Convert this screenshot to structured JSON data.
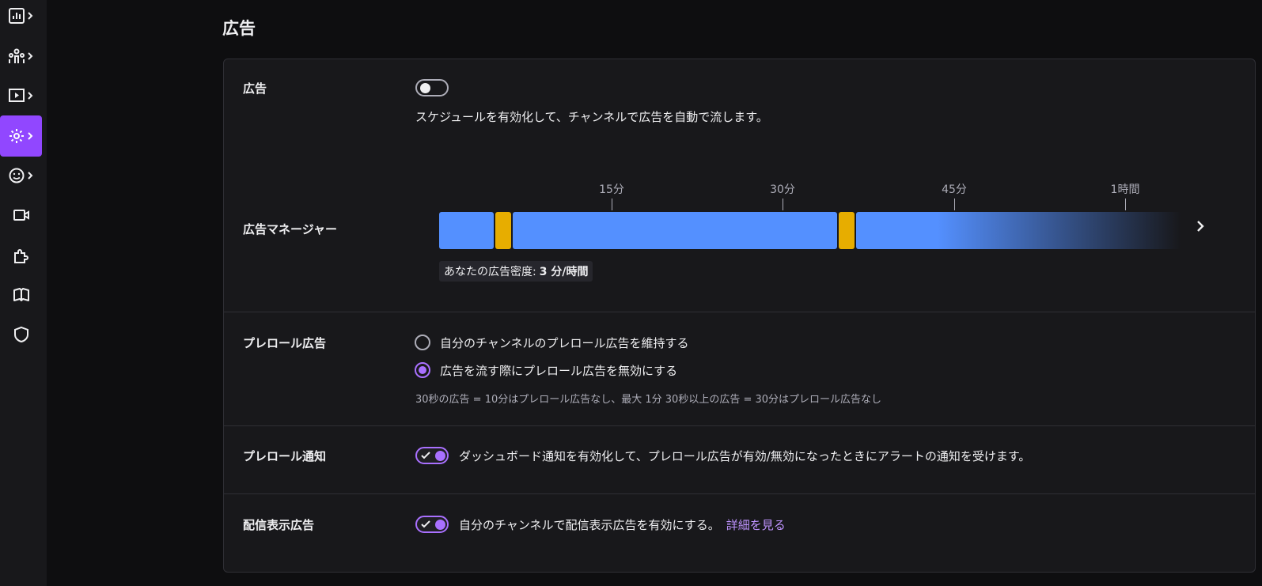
{
  "page": {
    "title": "広告"
  },
  "colors": {
    "accent": "#9147ff",
    "ad_blue": "#5490ff",
    "ad_gold": "#e7ad00",
    "link": "#bf94ff"
  },
  "sidebar": {
    "items": [
      {
        "icon": "analytics-icon",
        "expandable": true,
        "active": false
      },
      {
        "icon": "community-icon",
        "expandable": true,
        "active": false
      },
      {
        "icon": "content-icon",
        "expandable": true,
        "active": false
      },
      {
        "icon": "gear-icon",
        "expandable": true,
        "active": true
      },
      {
        "icon": "viewer-reward-icon",
        "expandable": true,
        "active": false
      },
      {
        "icon": "stream-video-icon",
        "expandable": false,
        "active": false
      },
      {
        "icon": "extensions-icon",
        "expandable": false,
        "active": false
      },
      {
        "icon": "book-icon",
        "expandable": false,
        "active": false
      },
      {
        "icon": "shield-icon",
        "expandable": false,
        "active": false
      }
    ]
  },
  "ads": {
    "label": "広告",
    "enabled": false,
    "description": "スケジュールを有効化して、チャンネルで広告を自動で流します。"
  },
  "ad_manager": {
    "label": "広告マネージャー",
    "ticks": [
      "15分",
      "30分",
      "45分",
      "1時間"
    ],
    "density_label": "あなたの広告密度:",
    "density_value": "3 分/時間"
  },
  "preroll": {
    "label": "プレロール広告",
    "options": [
      {
        "label": "自分のチャンネルのプレロール広告を維持する",
        "selected": false
      },
      {
        "label": "広告を流す際にプレロール広告を無効にする",
        "selected": true
      }
    ],
    "note": "30秒の広告 = 10分はプレロール広告なし、最大 1分 30秒以上の広告 = 30分はプレロール広告なし"
  },
  "preroll_notice": {
    "label": "プレロール通知",
    "enabled": true,
    "description": "ダッシュボード通知を有効化して、プレロール広告が有効/無効になったときにアラートの通知を受けます。"
  },
  "display_ads": {
    "label": "配信表示広告",
    "enabled": true,
    "description": "自分のチャンネルで配信表示広告を有効にする。",
    "link": "詳細を見る"
  }
}
